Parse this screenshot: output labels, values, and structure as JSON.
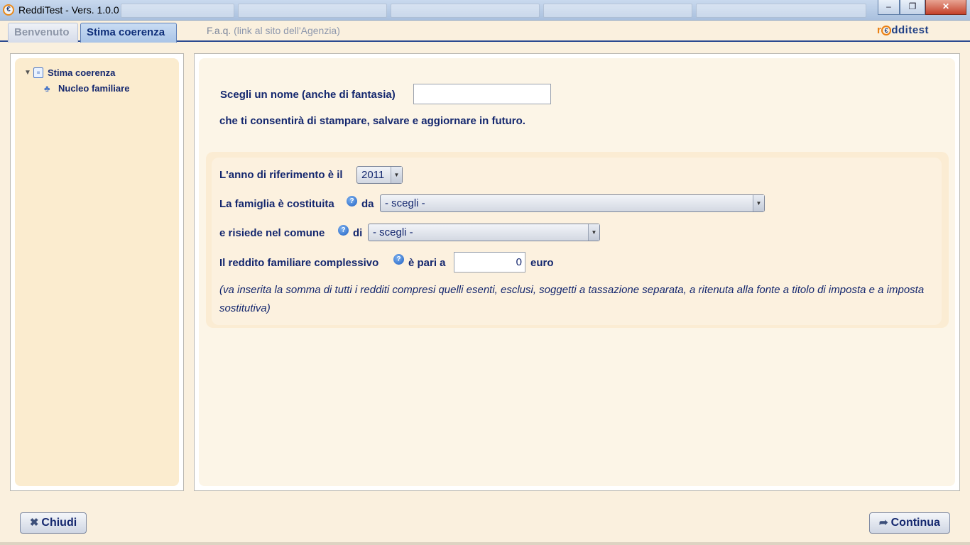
{
  "window": {
    "title": "ReddiTest - Vers. 1.0.0",
    "minimize_glyph": "–",
    "restore_glyph": "❐",
    "close_glyph": "✕"
  },
  "tabs": [
    {
      "label": "Benvenuto",
      "active": false
    },
    {
      "label": "Stima coerenza",
      "active": true
    }
  ],
  "faq": {
    "label": "F.a.q.",
    "sub": "(link al sito dell'Agenzia)"
  },
  "logo": {
    "left": "r",
    "right": "dditest"
  },
  "tree": {
    "root_label": "Stima coerenza",
    "child_label": "Nucleo familiare"
  },
  "form": {
    "name_label": "Scegli un nome (anche di fantasia)",
    "name_value": "",
    "name_hint": "che ti consentirà di stampare, salvare e aggiornare in futuro.",
    "year_label": "L'anno di riferimento è il",
    "year_value": "2011",
    "family_label": "La famiglia è costituita",
    "family_suffix": "da",
    "family_value": "- scegli -",
    "comune_label": "e risiede nel comune",
    "comune_suffix": "di",
    "comune_value": "- scegli -",
    "income_label": "Il reddito familiare complessivo",
    "income_suffix": "è pari a",
    "income_value": "0",
    "income_unit": "euro",
    "note": "(va inserita la somma di tutti i redditi compresi quelli esenti, esclusi, soggetti a tassazione separata, a ritenuta alla fonte a titolo di imposta e a imposta sostitutiva)"
  },
  "buttons": {
    "close_label": "Chiudi",
    "continue_label": "Continua"
  },
  "icons": {
    "close_button_icon": "close-icon",
    "continue_button_icon": "arrow-icon",
    "help_icon": "help-icon"
  },
  "colors": {
    "accent": "#14276e",
    "logo_orange": "#ea7f12",
    "background": "#faf0de"
  }
}
